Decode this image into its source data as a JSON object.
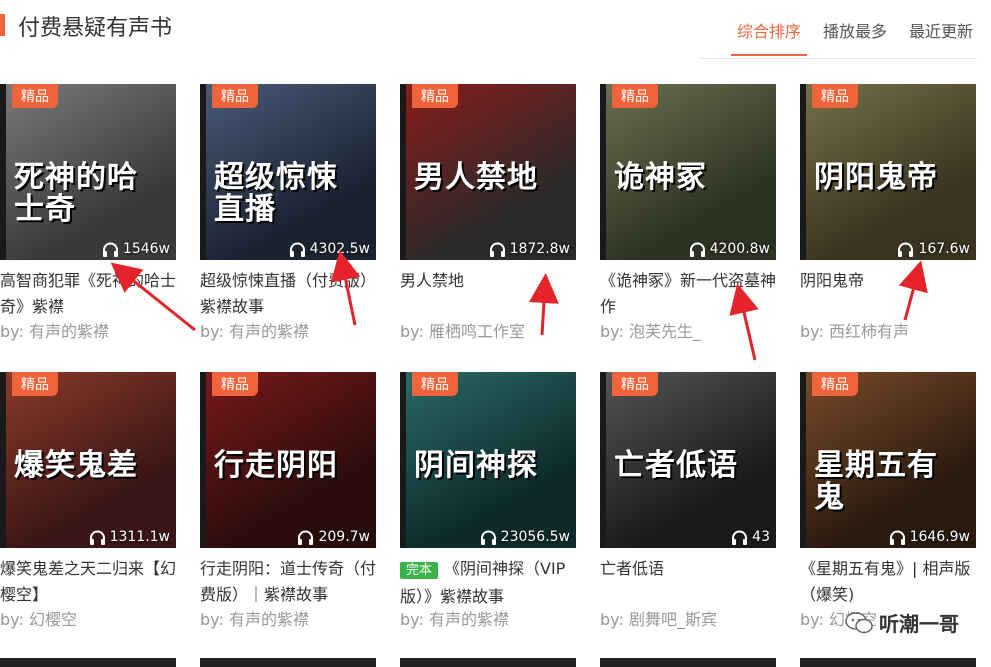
{
  "header": {
    "title": "付费悬疑有声书",
    "tabs": [
      {
        "label": "综合排序",
        "active": true
      },
      {
        "label": "播放最多",
        "active": false
      },
      {
        "label": "最近更新",
        "active": false
      }
    ]
  },
  "books": [
    {
      "badge": "精品",
      "cover_text": "死神的哈士奇",
      "plays": "1546w",
      "title": "高智商犯罪《死神的哈士奇》紫襟",
      "author": "by: 有声的紫襟",
      "colors": [
        "#3a3a3a",
        "#7a7a7a"
      ],
      "done": ""
    },
    {
      "badge": "精品",
      "cover_text": "超级惊悚直播",
      "plays": "4302.5w",
      "title": "超级惊悚直播（付费版）紫襟故事",
      "author": "by: 有声的紫襟",
      "colors": [
        "#1b2333",
        "#4a5a78"
      ],
      "done": ""
    },
    {
      "badge": "精品",
      "cover_text": "男人禁地",
      "plays": "1872.8w",
      "title": "男人禁地",
      "author": "by: 雁栖鸣工作室",
      "colors": [
        "#2a2a2a",
        "#8a1c1c"
      ],
      "done": ""
    },
    {
      "badge": "精品",
      "cover_text": "诡神冢",
      "plays": "4200.8w",
      "title": "《诡神冢》新一代盗墓神作",
      "author": "by: 泡芙先生_",
      "colors": [
        "#2d3323",
        "#6b7050"
      ],
      "done": ""
    },
    {
      "badge": "精品",
      "cover_text": "阴阳鬼帝",
      "plays": "167.6w",
      "title": "阴阳鬼帝",
      "author": "by: 西红柿有声",
      "colors": [
        "#3a3320",
        "#77704a"
      ],
      "done": ""
    },
    {
      "badge": "精品",
      "cover_text": "爆笑鬼差",
      "plays": "1311.1w",
      "title": "爆笑鬼差之天二归来【幻樱空】",
      "author": "by: 幻樱空",
      "colors": [
        "#3a1616",
        "#8a3a2a"
      ],
      "done": ""
    },
    {
      "badge": "精品",
      "cover_text": "行走阴阳",
      "plays": "209.7w",
      "title": "行走阴阳：道士传奇（付费版）｜紫襟故事",
      "author": "by: 有声的紫襟",
      "colors": [
        "#2a0c0c",
        "#7a1a1a"
      ],
      "done": ""
    },
    {
      "badge": "精品",
      "cover_text": "阴间神探",
      "plays": "23056.5w",
      "title": "《阴间神探（VIP版）》紫襟故事",
      "author": "by: 有声的紫襟",
      "colors": [
        "#0e2a2a",
        "#2a6a68"
      ],
      "done": "完本"
    },
    {
      "badge": "精品",
      "cover_text": "亡者低语",
      "plays": "43",
      "title": "亡者低语",
      "author": "by: 剧舞吧_斯宾",
      "colors": [
        "#1a1a1a",
        "#555555"
      ],
      "done": ""
    },
    {
      "badge": "精品",
      "cover_text": "星期五有鬼",
      "plays": "1646.9w",
      "title": "《星期五有鬼》| 相声版（爆笑)",
      "author": "by: 幻樱空",
      "colors": [
        "#2a1a10",
        "#7a4a2a"
      ],
      "done": ""
    }
  ],
  "watermark": {
    "text": "听潮一哥",
    "icon": "wechat-icon"
  },
  "accent_color": "#f0643c"
}
